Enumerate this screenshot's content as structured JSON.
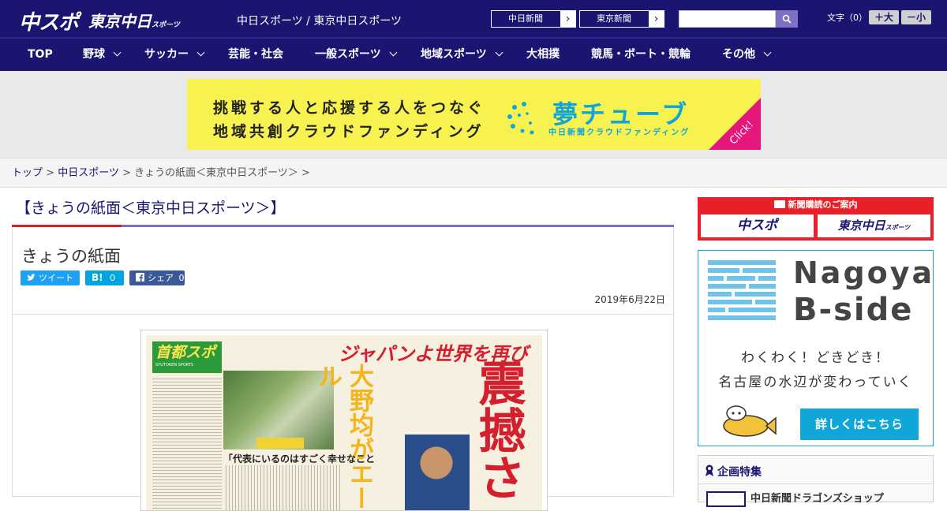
{
  "header": {
    "logo_main": "中スポ",
    "logo_tokyo": "東京中日",
    "logo_tokyo_small": "スポーツ",
    "site_names": "中日スポーツ / 東京中日スポーツ",
    "link_chunichi": "中日新聞",
    "link_tokyo": "東京新聞",
    "search_placeholder": "",
    "font_size_label": "文字（0）",
    "font_bigger": "＋大",
    "font_smaller": "－小"
  },
  "nav": {
    "items": [
      {
        "label": "TOP",
        "dropdown": false
      },
      {
        "label": "野球",
        "dropdown": true
      },
      {
        "label": "サッカー",
        "dropdown": true
      },
      {
        "label": "芸能・社会",
        "dropdown": false
      },
      {
        "label": "一般スポーツ",
        "dropdown": true
      },
      {
        "label": "地域スポーツ",
        "dropdown": true
      },
      {
        "label": "大相撲",
        "dropdown": false
      },
      {
        "label": "競馬・ボート・競輪",
        "dropdown": false
      },
      {
        "label": "その他",
        "dropdown": true
      }
    ]
  },
  "banner": {
    "line1": "挑戦する人と応援する人をつなぐ",
    "line2": "地域共創クラウドファンディング",
    "title": "夢チューブ",
    "subtitle": "中日新聞クラウドファンディング",
    "click": "Click!"
  },
  "breadcrumb": {
    "home": "トップ",
    "sep1": " > ",
    "section": "中日スポーツ",
    "sep2": " > ",
    "current": "きょうの紙面＜東京中日スポーツ＞ >"
  },
  "page": {
    "heading": "【きょうの紙面＜東京中日スポーツ＞】",
    "article_title": "きょうの紙面",
    "tweet_label": "ツイート",
    "hatena_label": "B!",
    "hatena_count": "0",
    "fb_label": "シェア",
    "fb_count": "0",
    "date": "2019年6月22日"
  },
  "newspaper": {
    "masthead": "首都スポ",
    "masthead_sub": "SYUTOKEN SPORTS",
    "headline_top": "ジャパンよ世界を再び",
    "headline_main": "震撼さ",
    "headline_side": "大野均がエール",
    "quote": "「代表にいるのはすごく幸せなこと"
  },
  "sidebar": {
    "subscribe_head": "新聞購読のご案内",
    "sub_chuspo": "中スポ",
    "sub_tokyo": "東京中日",
    "sub_tokyo_small": "スポーツ",
    "nagoya_title1": "Nagoya",
    "nagoya_title2": "B-side",
    "nagoya_line1": "わくわく！どきどき！",
    "nagoya_line2": "名古屋の水辺が変わっていく",
    "nagoya_button": "詳しくはこちら",
    "special_head": "企画特集",
    "special_item": "中日新聞ドラゴンズショップ"
  },
  "colors": {
    "brand_navy": "#1a1570",
    "accent_purple": "#7f6fc2",
    "accent_red": "#d4202e",
    "banner_yellow": "#f7f250",
    "banner_blue": "#11a6d8",
    "twitter": "#1da1f2",
    "hatena": "#00a4de",
    "facebook": "#3b5998"
  }
}
